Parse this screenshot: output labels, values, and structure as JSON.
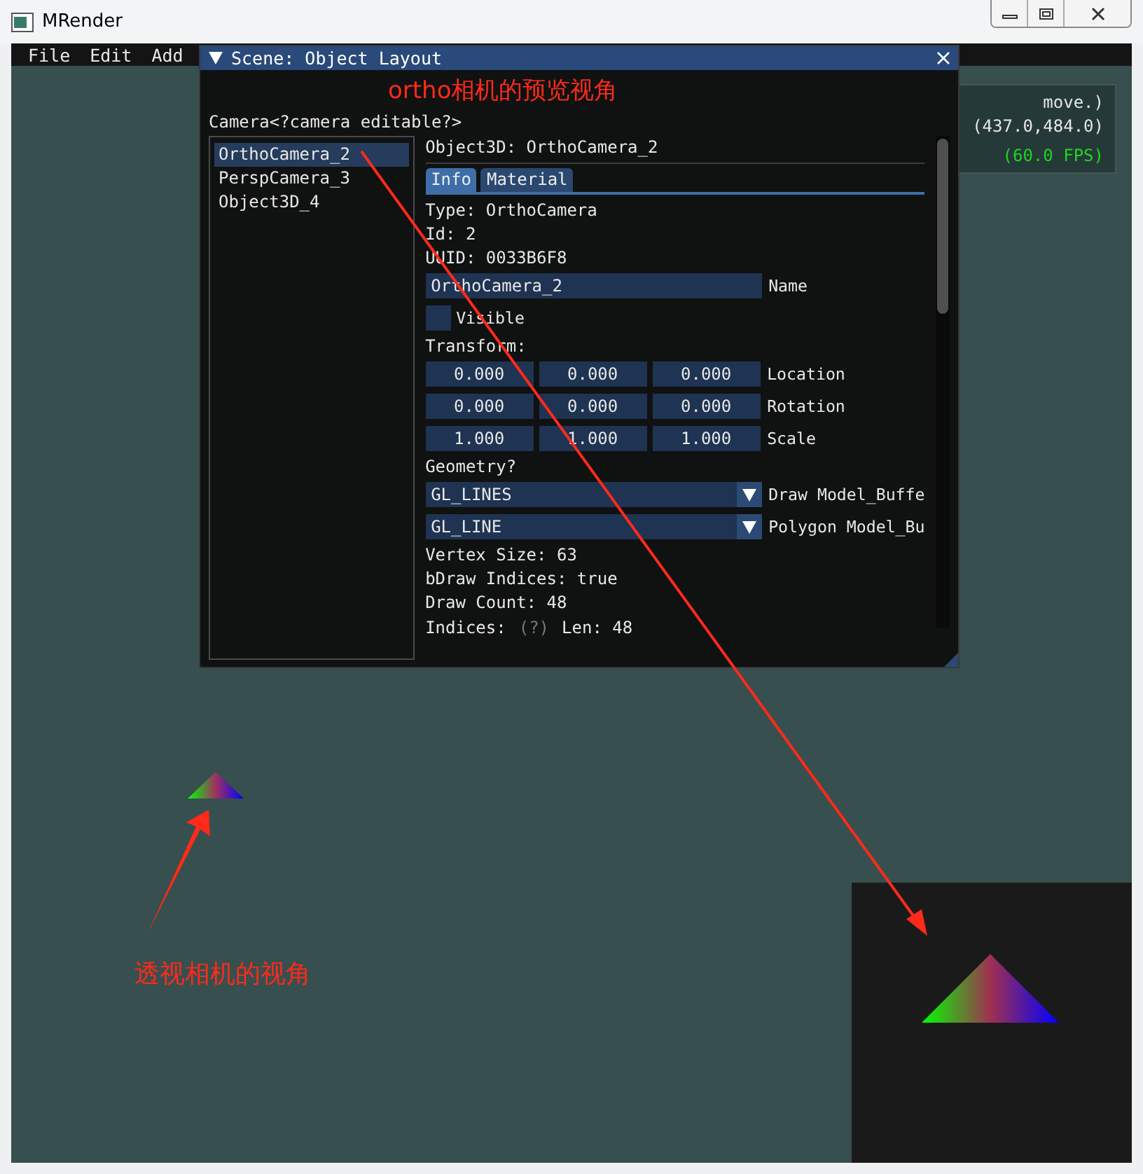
{
  "window": {
    "title": "MRender"
  },
  "menu": [
    "File",
    "Edit",
    "Add"
  ],
  "scene_window": {
    "title": "Scene: Object Layout",
    "prompt": "Camera<?camera editable?>",
    "objects": [
      {
        "label": "OrthoCamera_2",
        "selected": true
      },
      {
        "label": "PerspCamera_3",
        "selected": false
      },
      {
        "label": "Object3D_4",
        "selected": false
      }
    ],
    "header": "Object3D: OrthoCamera_2",
    "tabs": [
      {
        "label": "Info",
        "selected": true
      },
      {
        "label": "Material",
        "selected": false
      }
    ],
    "info_lines": [
      "Type: OrthoCamera",
      "Id: 2",
      "UUID: 0033B6F8"
    ],
    "name_field": {
      "value": "OrthoCamera_2",
      "label": "Name"
    },
    "visible": {
      "label": "Visible",
      "checked": false
    },
    "transform_label": "Transform:",
    "transform": [
      {
        "label": "Location",
        "values": [
          "0.000",
          "0.000",
          "0.000"
        ]
      },
      {
        "label": "Rotation",
        "values": [
          "0.000",
          "0.000",
          "0.000"
        ]
      },
      {
        "label": "Scale",
        "values": [
          "1.000",
          "1.000",
          "1.000"
        ]
      }
    ],
    "geometry_label": "Geometry?",
    "combos": [
      {
        "value": "GL_LINES",
        "label": "Draw Model_Buffe"
      },
      {
        "value": "GL_LINE",
        "label": "Polygon Model_Bu"
      }
    ],
    "stats": [
      "Vertex Size: 63",
      "bDraw Indices: true",
      "Draw Count: 48"
    ],
    "indices": {
      "label": "Indices:",
      "help": "(?)",
      "length": "Len: 48"
    }
  },
  "overlay": {
    "lines": [
      "move.)",
      "(437.0,484.0)"
    ],
    "fps": "(60.0 FPS)"
  },
  "annotations": [
    {
      "text": "ortho相机的预览视角"
    },
    {
      "text": "透视相机的视角"
    }
  ]
}
